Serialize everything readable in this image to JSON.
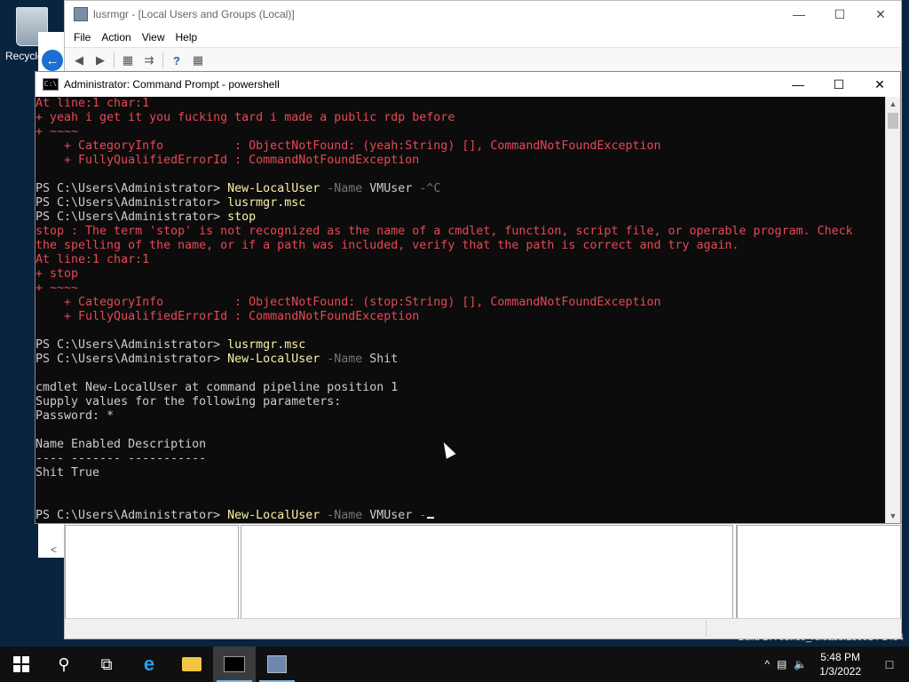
{
  "desktop": {
    "recycle_bin_label": "Recycle Bin",
    "build_text": "Build 17763.rs5_release.180914-1434"
  },
  "mmc": {
    "title": "lusrmgr - [Local Users and Groups (Local)]",
    "menu": [
      "File",
      "Action",
      "View",
      "Help"
    ],
    "scroll_left_glyph": "<"
  },
  "cmd": {
    "title": "Administrator: Command Prompt - powershell",
    "lines": [
      {
        "type": "err",
        "text": "At line:1 char:1"
      },
      {
        "type": "err",
        "text": "+ yeah i get it you fucking tard i made a public rdp before"
      },
      {
        "type": "err",
        "text": "+ ~~~~"
      },
      {
        "type": "err",
        "text": "    + CategoryInfo          : ObjectNotFound: (yeah:String) [], CommandNotFoundException"
      },
      {
        "type": "err",
        "text": "    + FullyQualifiedErrorId : CommandNotFoundException"
      },
      {
        "type": "plain",
        "text": ""
      },
      {
        "type": "cmd",
        "prompt": "PS C:\\Users\\Administrator> ",
        "cmdlet": "New-LocalUser",
        "param": " -Name",
        "arg": " VMUser",
        "tail": " -^C"
      },
      {
        "type": "cmd",
        "prompt": "PS C:\\Users\\Administrator> ",
        "cmdlet": "lusrmgr.msc",
        "param": "",
        "arg": "",
        "tail": ""
      },
      {
        "type": "cmd",
        "prompt": "PS C:\\Users\\Administrator> ",
        "cmdlet": "stop",
        "param": "",
        "arg": "",
        "tail": ""
      },
      {
        "type": "err",
        "text": "stop : The term 'stop' is not recognized as the name of a cmdlet, function, script file, or operable program. Check"
      },
      {
        "type": "err",
        "text": "the spelling of the name, or if a path was included, verify that the path is correct and try again."
      },
      {
        "type": "err",
        "text": "At line:1 char:1"
      },
      {
        "type": "err",
        "text": "+ stop"
      },
      {
        "type": "err",
        "text": "+ ~~~~"
      },
      {
        "type": "err",
        "text": "    + CategoryInfo          : ObjectNotFound: (stop:String) [], CommandNotFoundException"
      },
      {
        "type": "err",
        "text": "    + FullyQualifiedErrorId : CommandNotFoundException"
      },
      {
        "type": "plain",
        "text": ""
      },
      {
        "type": "cmd",
        "prompt": "PS C:\\Users\\Administrator> ",
        "cmdlet": "lusrmgr.msc",
        "param": "",
        "arg": "",
        "tail": ""
      },
      {
        "type": "cmd",
        "prompt": "PS C:\\Users\\Administrator> ",
        "cmdlet": "New-LocalUser",
        "param": " -Name",
        "arg": " Shit",
        "tail": ""
      },
      {
        "type": "plain",
        "text": ""
      },
      {
        "type": "plain",
        "text": "cmdlet New-LocalUser at command pipeline position 1"
      },
      {
        "type": "plain",
        "text": "Supply values for the following parameters:"
      },
      {
        "type": "plain",
        "text": "Password: *"
      },
      {
        "type": "plain",
        "text": ""
      },
      {
        "type": "plain",
        "text": "Name Enabled Description"
      },
      {
        "type": "plain",
        "text": "---- ------- -----------"
      },
      {
        "type": "plain",
        "text": "Shit True"
      },
      {
        "type": "plain",
        "text": ""
      },
      {
        "type": "plain",
        "text": ""
      },
      {
        "type": "cmd",
        "prompt": "PS C:\\Users\\Administrator> ",
        "cmdlet": "New-LocalUser",
        "param": " -Name",
        "arg": " VMUser",
        "tail": " -",
        "cursor": true
      }
    ]
  },
  "taskbar": {
    "clock_time": "5:48 PM",
    "clock_date": "1/3/2022",
    "tray_chevron": "^"
  }
}
